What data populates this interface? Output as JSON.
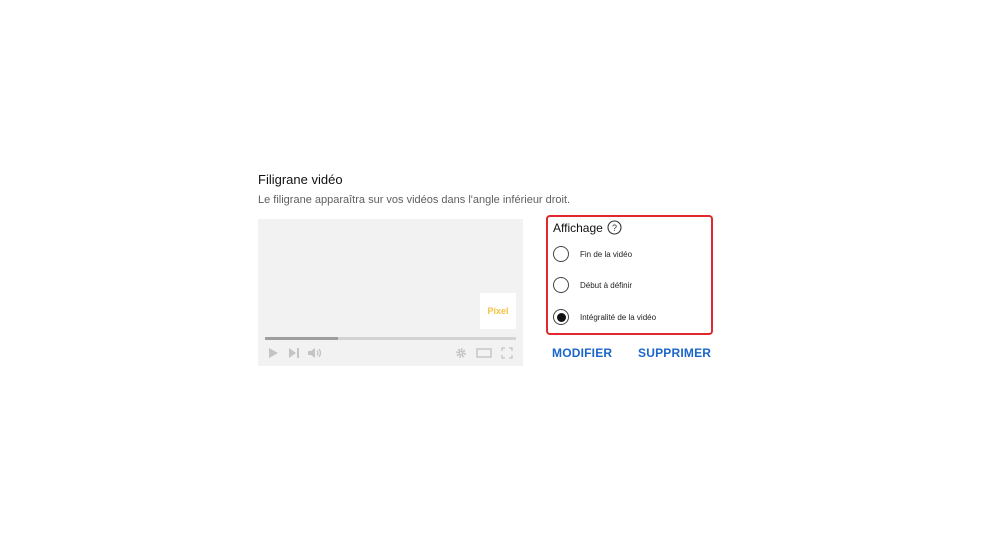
{
  "section": {
    "title": "Filigrane vidéo",
    "description": "Le filigrane apparaîtra sur vos vidéos dans l'angle inférieur droit."
  },
  "preview": {
    "watermark_label": "Pixel",
    "progress": 0.29,
    "accent_color": "#f5c242"
  },
  "display": {
    "heading": "Affichage",
    "help_icon": "help-icon",
    "options": [
      {
        "label": "Fin de la vidéo",
        "selected": false
      },
      {
        "label": "Début à définir",
        "selected": false
      },
      {
        "label": "Intégralité de la vidéo",
        "selected": true
      }
    ]
  },
  "actions": {
    "modify_label": "MODIFIER",
    "delete_label": "SUPPRIMER"
  },
  "colors": {
    "highlight_border": "#e0282e",
    "link_blue": "#1a66c9"
  }
}
